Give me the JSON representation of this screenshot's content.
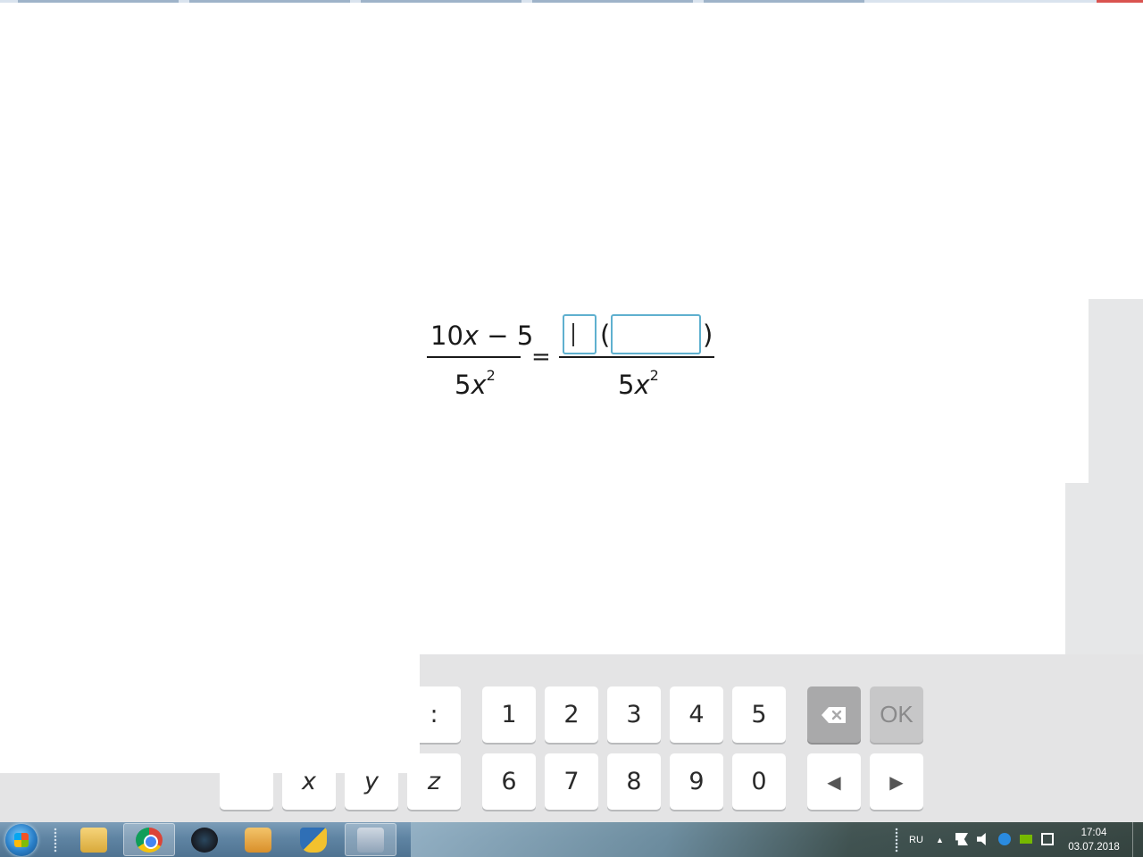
{
  "equation": {
    "lhs_numerator": [
      "10",
      "x",
      " − 5"
    ],
    "lhs_denominator": [
      "5",
      "x",
      "2"
    ],
    "equals": "=",
    "rhs_open_paren": "(",
    "rhs_close_paren": ")",
    "rhs_denominator": [
      "5",
      "x",
      "2"
    ],
    "input_boxes": [
      {
        "name": "factor",
        "value": ""
      },
      {
        "name": "bracket-content",
        "value": ""
      }
    ]
  },
  "keyboard": {
    "row1": [
      ":",
      "1",
      "2",
      "3",
      "4",
      "5"
    ],
    "row2": [
      "x",
      "y",
      "z",
      "6",
      "7",
      "8",
      "9",
      "0"
    ],
    "backspace_icon": "backspace-icon",
    "ok_label": "OK",
    "left_arrow": "◀",
    "right_arrow": "▶"
  },
  "taskbar": {
    "apps": [
      "start-orb",
      "file-explorer",
      "chrome",
      "steam",
      "media-player",
      "shield-app",
      "calculator"
    ],
    "language": "RU",
    "time": "17:04",
    "date": "03.07.2018"
  },
  "colors": {
    "input_border": "#5fb0cf",
    "keyboard_bg": "#e4e4e5",
    "backspace_key": "#a9a9aa",
    "ok_key": "#c7c7c8"
  }
}
